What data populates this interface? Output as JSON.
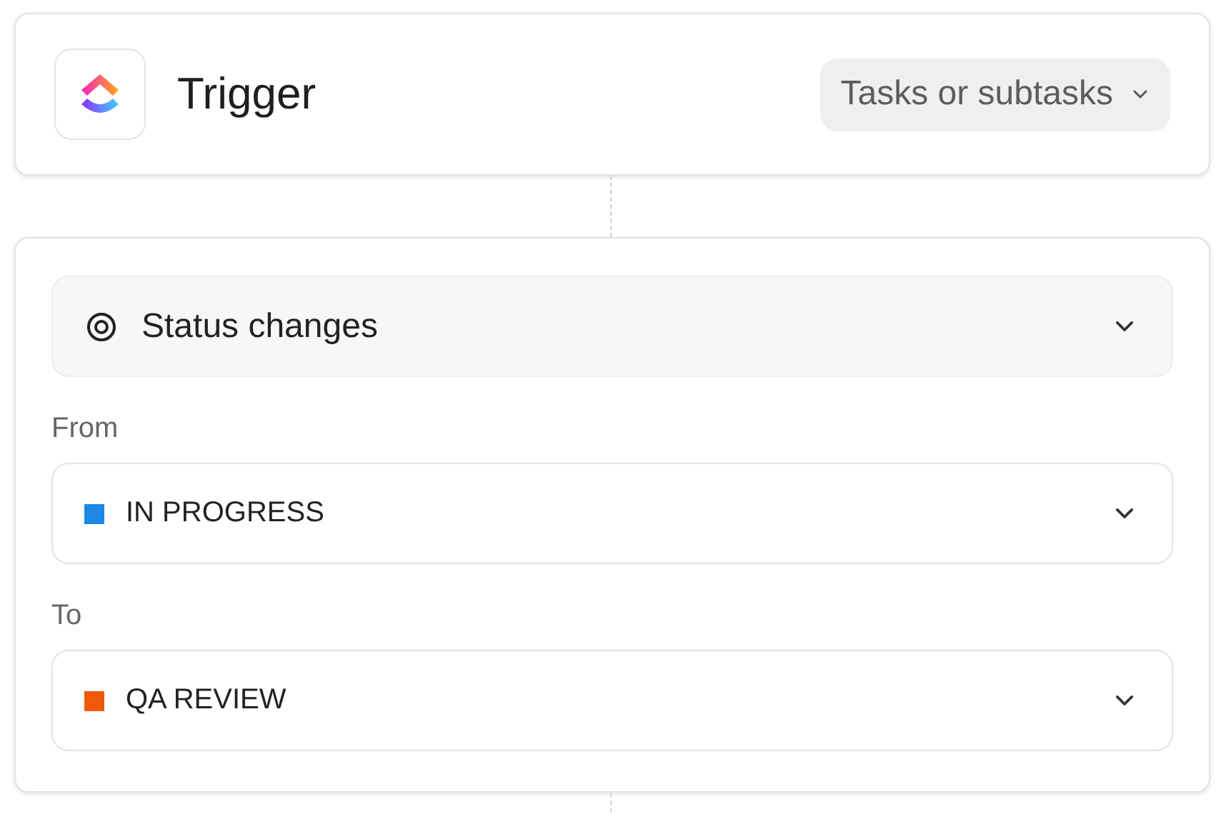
{
  "trigger": {
    "title": "Trigger",
    "scope": "Tasks or subtasks"
  },
  "condition": {
    "event": "Status changes",
    "fields": [
      {
        "label": "From",
        "value": "IN PROGRESS",
        "color": "#1e88e5"
      },
      {
        "label": "To",
        "value": "QA REVIEW",
        "color": "#ef5a0a"
      }
    ]
  }
}
